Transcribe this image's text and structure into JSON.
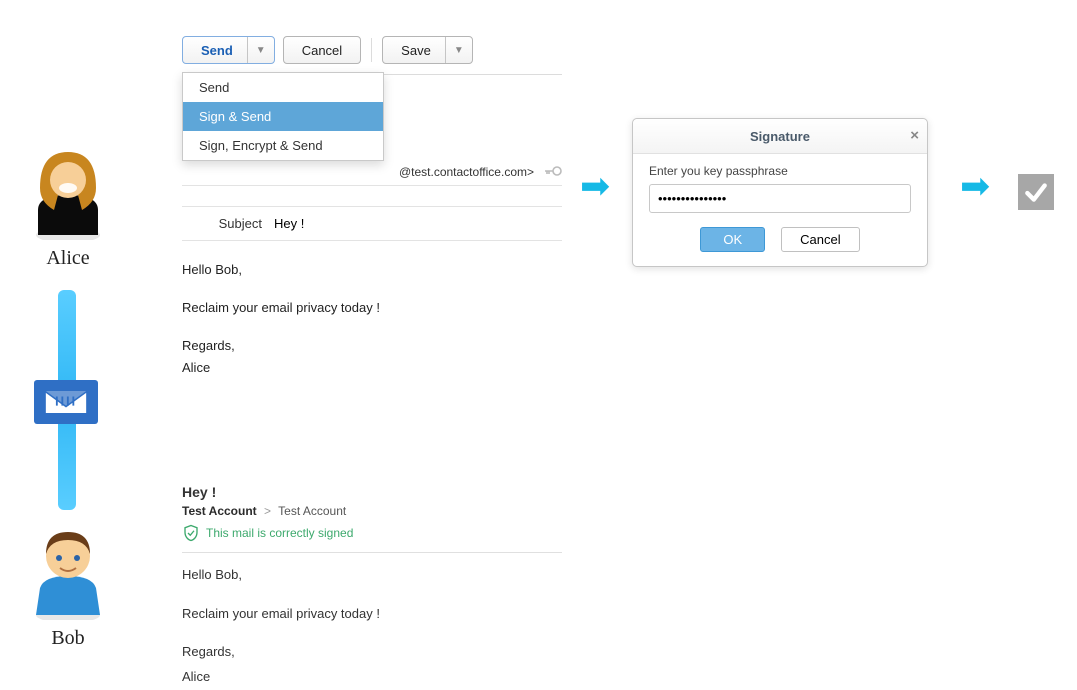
{
  "people": {
    "alice": "Alice",
    "bob": "Bob"
  },
  "compose": {
    "toolbar": {
      "send": "Send",
      "cancel": "Cancel",
      "save": "Save"
    },
    "send_menu": {
      "items": [
        {
          "label": "Send"
        },
        {
          "label": "Sign & Send"
        },
        {
          "label": "Sign, Encrypt & Send"
        }
      ]
    },
    "address_suffix": "@test.contactoffice.com>",
    "subject_label": "Subject",
    "subject": "Hey !",
    "body": {
      "p1": "Hello Bob,",
      "p2": "Reclaim your email privacy today !",
      "p3": "Regards,",
      "p4": "Alice"
    }
  },
  "dialog": {
    "title": "Signature",
    "prompt": "Enter you key passphrase",
    "value": "•••••••••••••••",
    "ok": "OK",
    "cancel": "Cancel"
  },
  "received": {
    "subject": "Hey !",
    "from": "Test Account",
    "to": "Test Account",
    "verified": "This mail is correctly signed",
    "body": {
      "p1": "Hello Bob,",
      "p2": "Reclaim your email privacy today !",
      "p3": "Regards,",
      "p4": "Alice"
    }
  }
}
